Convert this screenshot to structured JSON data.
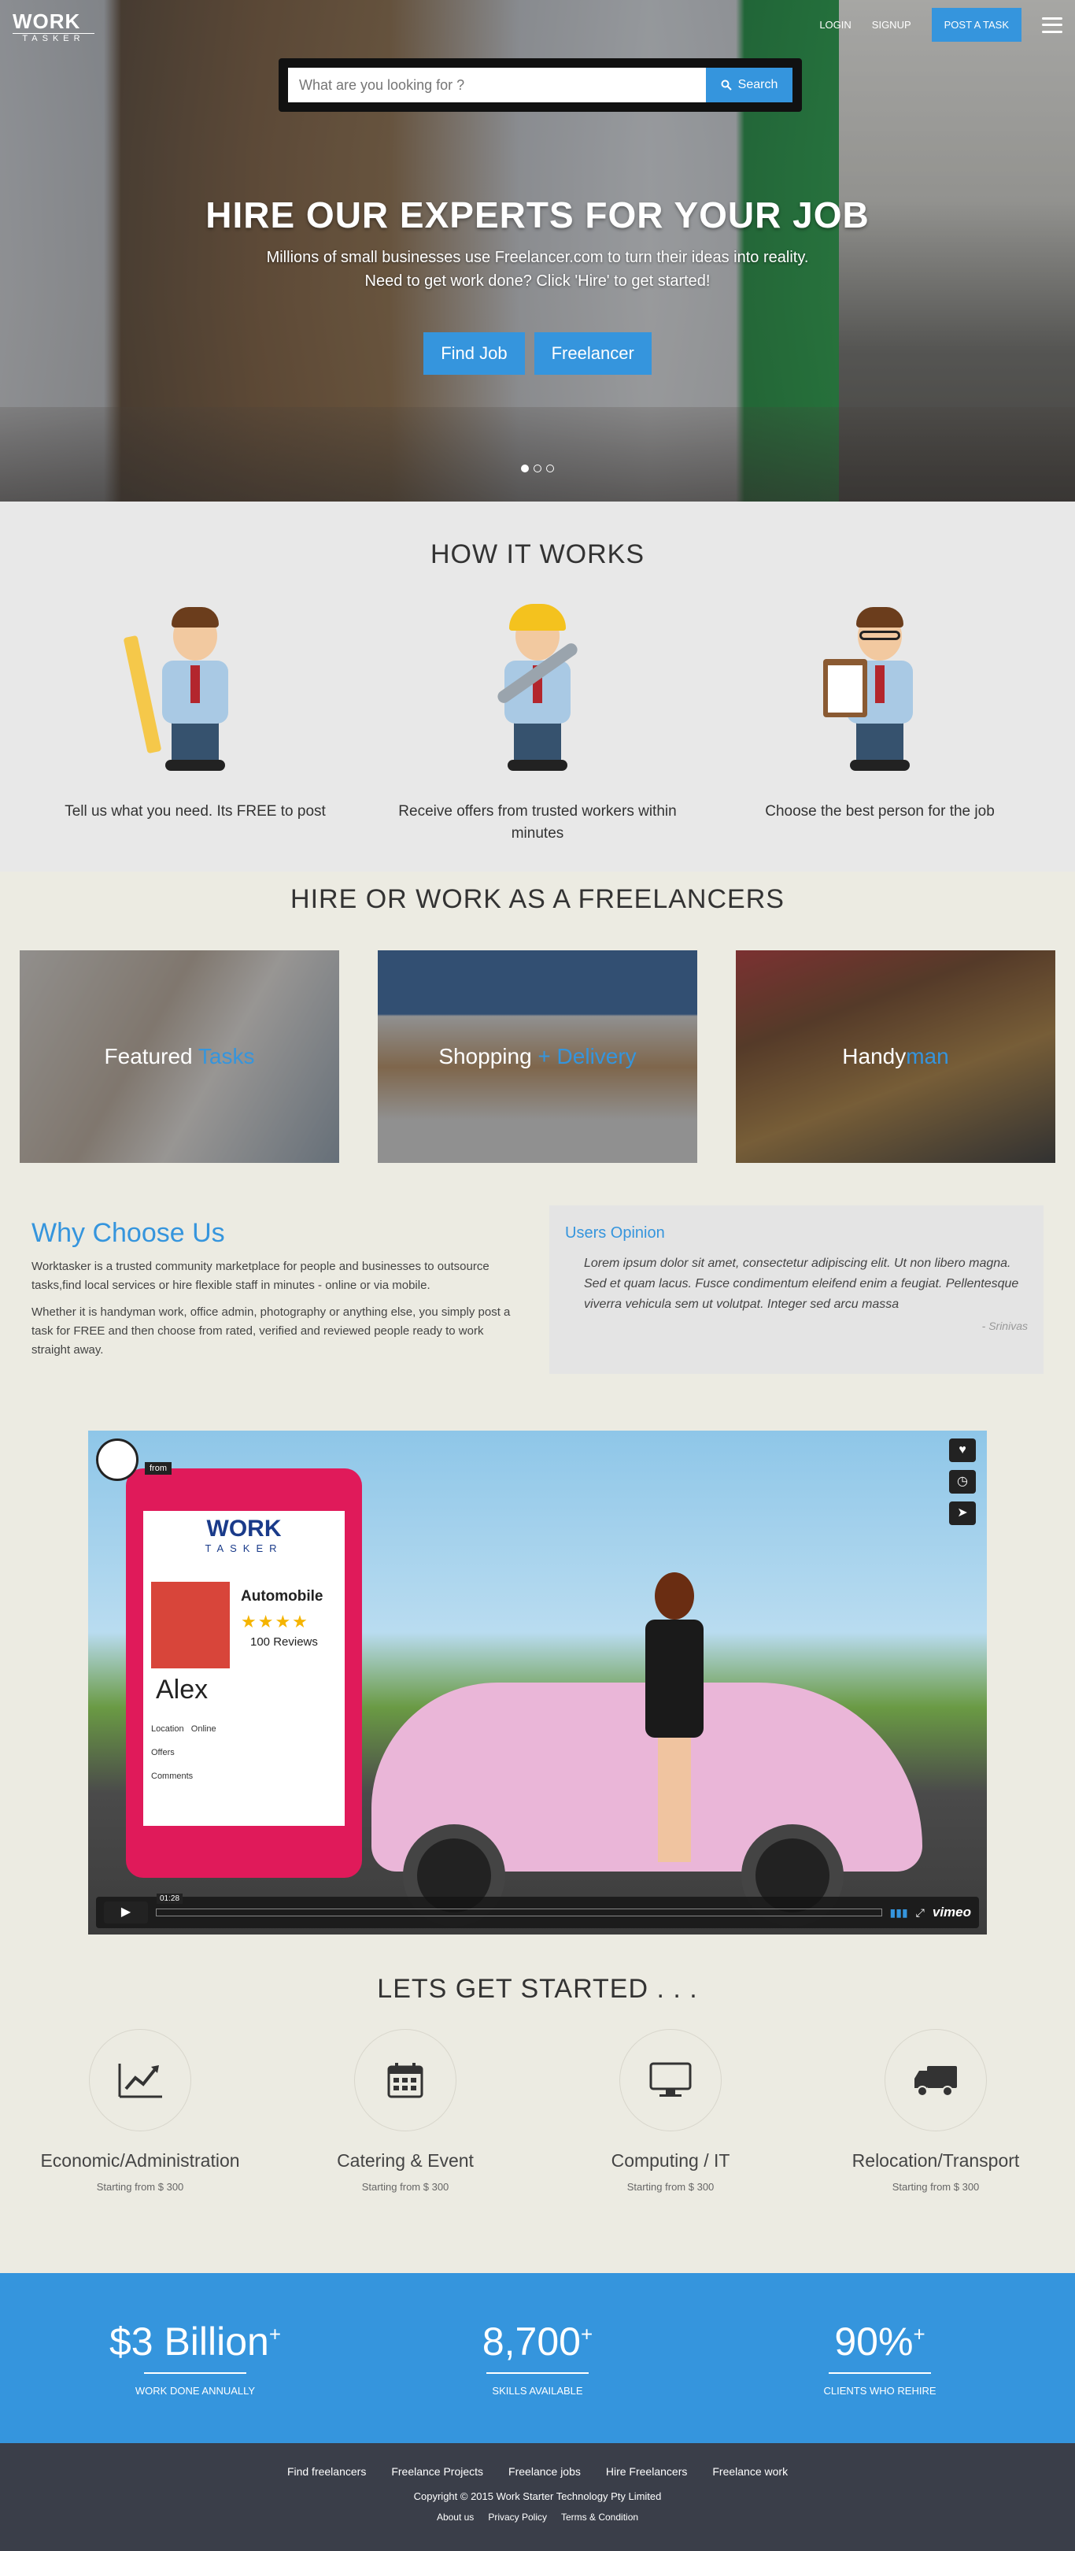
{
  "header": {
    "logo_word": "WORK",
    "logo_sub": "TASKER",
    "nav": [
      "LOGIN",
      "SIGNUP"
    ],
    "post_task": "POST A TASK"
  },
  "search": {
    "placeholder": "What are you looking for ?",
    "button": "Search"
  },
  "hero": {
    "title": "HIRE OUR EXPERTS FOR YOUR JOB",
    "subtitle": "Millions of small businesses use Freelancer.com to turn their ideas into reality. Need to get work done? Click 'Hire' to get started!",
    "buttons": [
      "Find Job",
      "Freelancer"
    ],
    "slides": 3,
    "active_slide": 1
  },
  "how": {
    "title": "HOW IT WORKS",
    "steps": [
      {
        "icon": "pencil-man-icon",
        "text": "Tell us what you need. Its FREE to post"
      },
      {
        "icon": "worker-wrench-icon",
        "text": "Receive offers from trusted workers within minutes"
      },
      {
        "icon": "clipboard-man-icon",
        "text": "Choose the best person for the job"
      }
    ]
  },
  "hire": {
    "title": "HIRE OR WORK AS A FREELANCERS",
    "cards": [
      {
        "a": "Featured ",
        "b": "Tasks"
      },
      {
        "a": "Shopping ",
        "b": "+ Delivery"
      },
      {
        "a": "Handy",
        "b": "man"
      }
    ]
  },
  "why": {
    "title": "Why Choose Us",
    "p1": "Worktasker is a trusted community marketplace for people and businesses to outsource tasks,find local services or hire flexible staff in minutes - online or via mobile.",
    "p2": "Whether it is handyman work, office admin, photography or anything else, you simply post a task for FREE and then choose from rated, verified and reviewed people ready to work straight away."
  },
  "opinion": {
    "title": "Users Opinion",
    "quote": "Lorem ipsum dolor sit amet, consectetur adipiscing elit. Ut non libero magna. Sed et quam lacus. Fusce condimentum eleifend enim a feugiat. Pellentesque viverra vehicula sem ut volutpat. Integer sed arcu massa",
    "author": "- Srinivas"
  },
  "video": {
    "from": "from",
    "brand": "WORK",
    "brand_sub": "TASKER",
    "profile_title": "Automobile",
    "rating": "★★★★",
    "reviews": "100  Reviews",
    "name": "Alex",
    "rows": [
      "Location",
      "Offers",
      "Comments"
    ],
    "location_value": "Online",
    "time": "01:28",
    "vimeo": "vimeo",
    "icons": [
      "heart-icon",
      "clock-icon",
      "send-icon"
    ]
  },
  "started": {
    "title": "LETS GET STARTED . . .",
    "cats": [
      {
        "name": "Economic/Administration",
        "price": "Starting from $ 300",
        "icon": "chart-icon",
        "glyph": "📈"
      },
      {
        "name": "Catering & Event",
        "price": "Starting from $ 300",
        "icon": "calendar-icon",
        "glyph": "📅"
      },
      {
        "name": "Computing / IT",
        "price": "Starting from $ 300",
        "icon": "monitor-icon",
        "glyph": "🖥"
      },
      {
        "name": "Relocation/Transport",
        "price": "Starting from $ 300",
        "icon": "truck-icon",
        "glyph": "🚚"
      }
    ]
  },
  "stats": [
    {
      "value": "$3 Billion",
      "plus": "+",
      "label": "WORK DONE ANNUALLY"
    },
    {
      "value": "8,700",
      "plus": "+",
      "label": "SKILLS AVAILABLE"
    },
    {
      "value": "90%",
      "plus": "+",
      "label": "CLIENTS WHO REHIRE"
    }
  ],
  "footer": {
    "links": [
      "Find freelancers",
      "Freelance Projects",
      "Freelance jobs",
      "Hire Freelancers",
      "Freelance work"
    ],
    "copyright": "Copyright © 2015 Work Starter Technology Pty Limited",
    "legal": [
      "About us",
      "Privacy Policy",
      "Terms & Condition"
    ]
  },
  "colors": {
    "accent": "#3595dd",
    "footer": "#3a3e49",
    "page": "#ecebe2"
  }
}
